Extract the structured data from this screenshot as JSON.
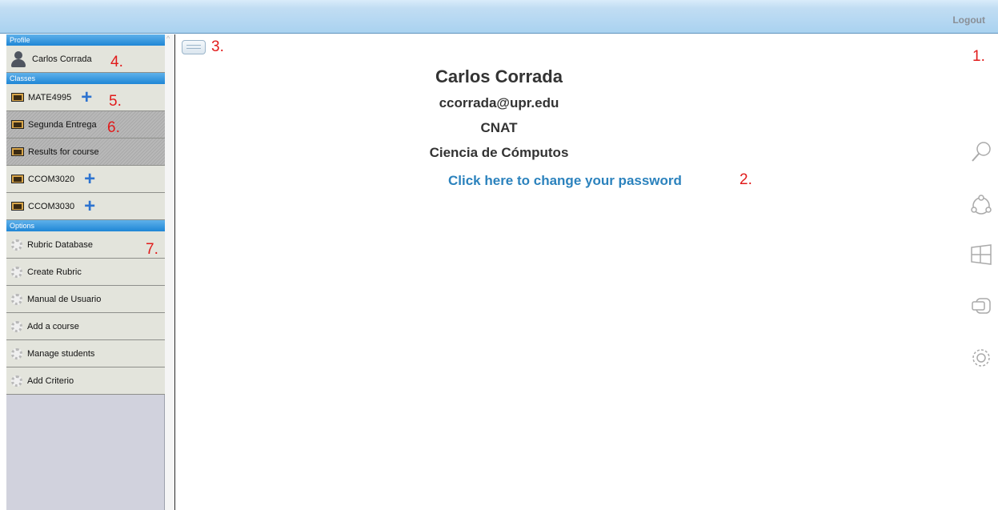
{
  "header": {
    "logout_label": "Logout"
  },
  "sidebar": {
    "profile_header": "Profile",
    "profile_name": "Carlos Corrada",
    "classes_header": "Classes",
    "classes": [
      "MATE4995",
      "Segunda Entrega",
      "Results for course",
      "CCOM3020",
      "CCOM3030"
    ],
    "options_header": "Options",
    "options": [
      "Rubric Database",
      "Create Rubric",
      "Manual de Usuario",
      "Add a course",
      "Manage students",
      "Add Criterio"
    ]
  },
  "profile": {
    "name": "Carlos Corrada",
    "email": "ccorrada@upr.edu",
    "department": "CNAT",
    "program": "Ciencia de Cómputos",
    "change_password": "Click here to change your password"
  },
  "annotations": [
    "1.",
    "2.",
    "3.",
    "4.",
    "5.",
    "6.",
    "7."
  ],
  "icons": [
    "menu-icon",
    "search-icon",
    "share-icon",
    "windows-icon",
    "devices-icon",
    "gear-icon"
  ],
  "colors": {
    "accent_blue": "#1f86d6",
    "link_blue": "#2b82bd",
    "annotation_red": "#e11b1b"
  }
}
